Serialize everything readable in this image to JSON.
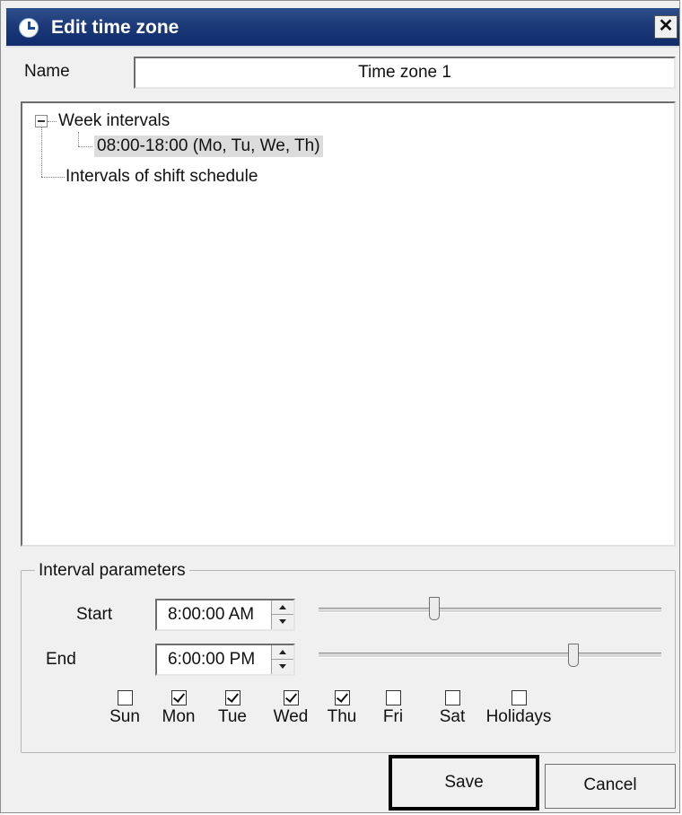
{
  "window": {
    "title": "Edit time zone",
    "close_label": "✕"
  },
  "name_field": {
    "label": "Name",
    "value": "Time zone 1"
  },
  "tree": {
    "root": {
      "label": "Week intervals",
      "expander": "−"
    },
    "child": {
      "label": "08:00-18:00 (Mo, Tu, We, Th)"
    },
    "sibling": {
      "label": "Intervals of shift schedule"
    }
  },
  "interval": {
    "group_title": "Interval parameters",
    "start": {
      "label": "Start",
      "value": "8:00:00 AM",
      "slider_fraction": 0.333
    },
    "end": {
      "label": "End",
      "value": "6:00:00 PM",
      "slider_fraction": 0.75
    },
    "days": [
      {
        "label": "Sun",
        "checked": false
      },
      {
        "label": "Mon",
        "checked": true
      },
      {
        "label": "Tue",
        "checked": true
      },
      {
        "label": "Wed",
        "checked": true
      },
      {
        "label": "Thu",
        "checked": true
      },
      {
        "label": "Fri",
        "checked": false
      },
      {
        "label": "Sat",
        "checked": false
      },
      {
        "label": "Holidays",
        "checked": false
      }
    ]
  },
  "buttons": {
    "save": "Save",
    "cancel": "Cancel"
  }
}
